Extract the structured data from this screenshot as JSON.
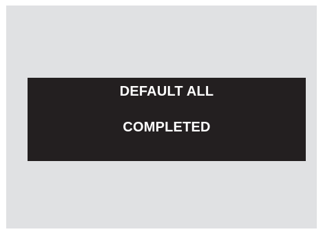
{
  "message": {
    "line1": "DEFAULT ALL",
    "line2": "COMPLETED"
  },
  "colors": {
    "background": "#e0e1e3",
    "banner": "#231f20",
    "text": "#ffffff"
  }
}
